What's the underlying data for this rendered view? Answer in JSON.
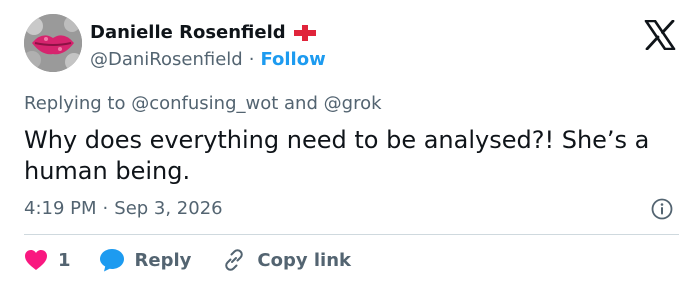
{
  "author": {
    "name": "Danielle Rosenfield",
    "flag_icon": "england-flag-icon",
    "handle": "@DaniRosenfield",
    "separator": "·",
    "follow_label": "Follow"
  },
  "logo": "x-logo-icon",
  "replying": {
    "prefix": "Replying to",
    "mention_1": "@confusing_wot",
    "conjunction": "and",
    "mention_2": "@grok"
  },
  "tweet": {
    "text": "Why does everything need to be analysed?! She’s a human being."
  },
  "meta": {
    "time": "4:19 PM",
    "separator": "·",
    "date": "Sep 3, 2026"
  },
  "actions": {
    "like_count": "1",
    "reply_label": "Reply",
    "copy_link_label": "Copy link"
  },
  "colors": {
    "text": "#0f1419",
    "secondary": "#536471",
    "accent": "#1d9bf0",
    "like": "#f91880",
    "flag_red": "#e0243b",
    "divider": "#cfd9de"
  }
}
